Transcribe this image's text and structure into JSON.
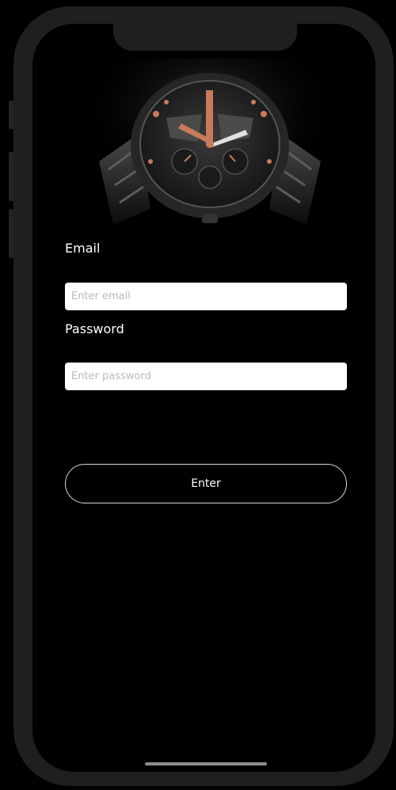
{
  "form": {
    "email_label": "Email",
    "email_placeholder": "Enter email",
    "email_value": "",
    "password_label": "Password",
    "password_placeholder": "Enter password",
    "password_value": "",
    "submit_label": "Enter"
  },
  "colors": {
    "background": "#000000",
    "frame": "#1f1f1f",
    "input_bg": "#ffffff",
    "accent_copper": "#c97a5a",
    "button_border": "#d9d9d9"
  },
  "icons": {
    "hero": "wristwatch-image"
  }
}
